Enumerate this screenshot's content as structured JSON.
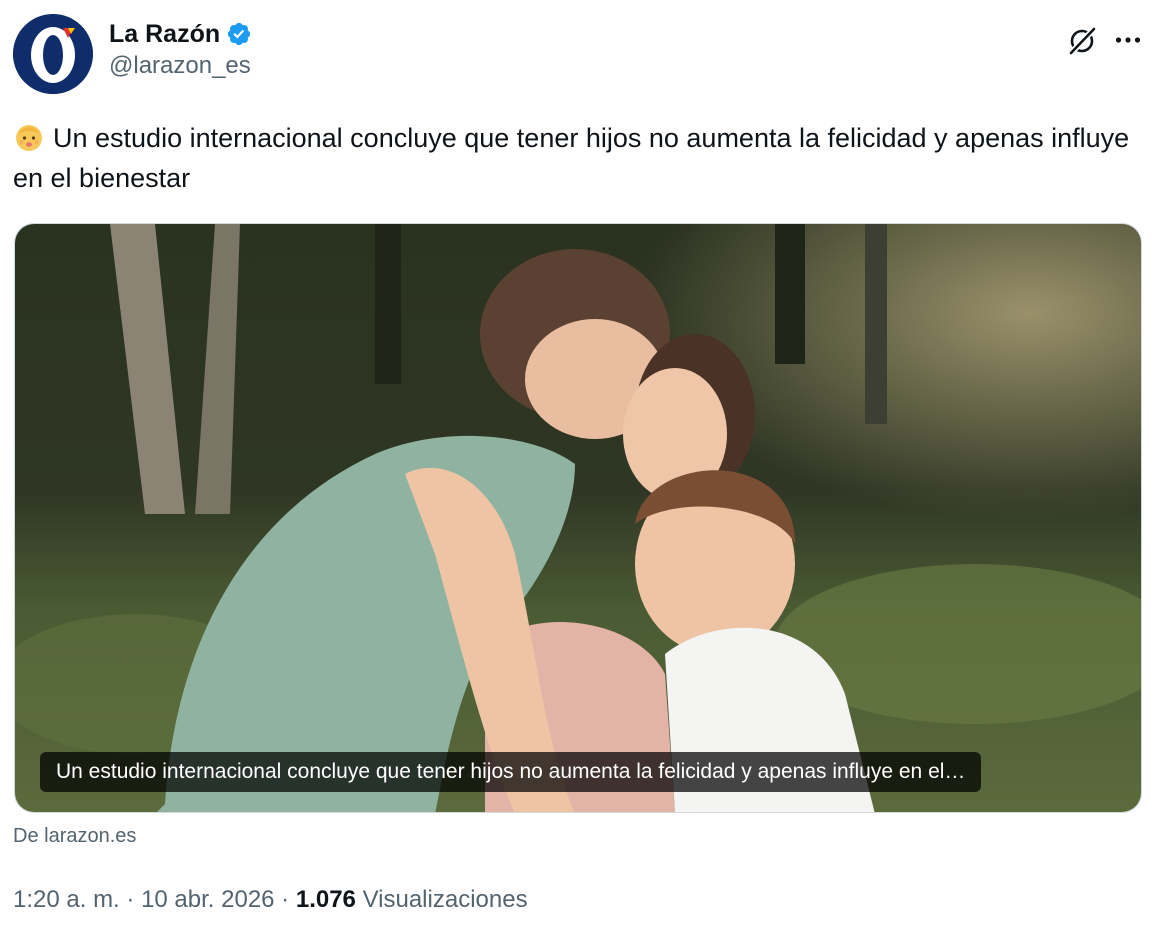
{
  "account": {
    "display_name": "La Razón",
    "handle": "@larazon_es",
    "verified": true,
    "avatar_icon": "la-razon-logo",
    "brand_color": "#0f2c6b"
  },
  "tweet": {
    "emoji": "👶",
    "text": "Un estudio internacional concluye que tener hijos no aumenta la felicidad y apenas influye en el bienestar"
  },
  "media": {
    "caption": "Un estudio internacional concluye que tener hijos no aumenta la felicidad y apenas influye en el…",
    "source": "De larazon.es"
  },
  "meta": {
    "time": "1:20 a. m.",
    "separator": " · ",
    "date": "10 abr. 2026",
    "views_count": "1.076",
    "views_label": "Visualizaciones"
  },
  "icons": {
    "verified": "verified-badge-icon",
    "grok": "grok-icon",
    "more": "more-dots-icon"
  },
  "colors": {
    "text_primary": "#0f1419",
    "text_secondary": "#536471",
    "verified_blue": "#1d9bf0"
  }
}
